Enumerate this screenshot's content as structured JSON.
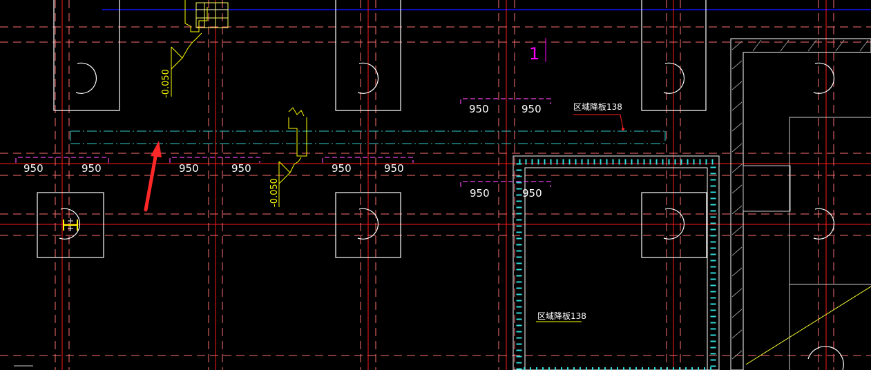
{
  "drawing": {
    "section_mark": "1",
    "dimensions": [
      "950",
      "950",
      "950",
      "950",
      "950",
      "950",
      "950",
      "950",
      "950",
      "950"
    ],
    "level_marks": [
      "-0.050",
      "-0.050"
    ],
    "labels": [
      "区域降板138",
      "区域降板138"
    ]
  },
  "colors": {
    "background": "#000000",
    "axis": "#ff0000",
    "dashed": "#ff8080",
    "pile": "#ffffff",
    "beam": "#00ffff",
    "dimension": "#ff00ff",
    "level": "#ffff00",
    "top_line": "#0000ff",
    "hatch": "#bbbbbb",
    "arrow": "#ff2020"
  }
}
